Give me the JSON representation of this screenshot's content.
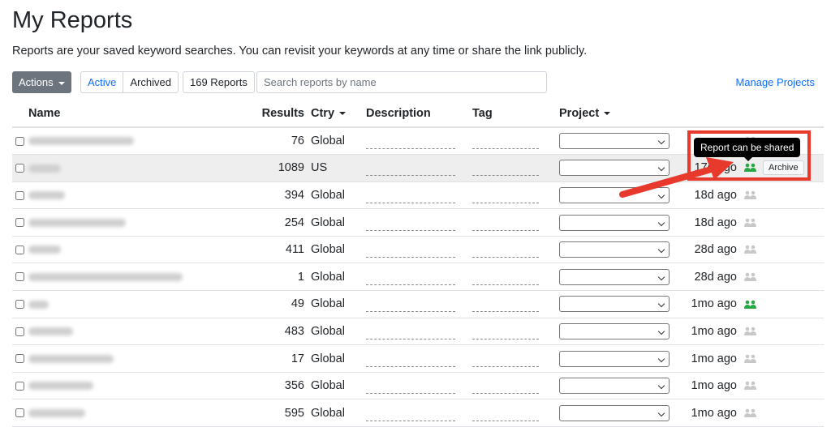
{
  "page": {
    "title": "My Reports",
    "subtitle": "Reports are your saved keyword searches. You can revisit your keywords at any time or share the link publicly."
  },
  "toolbar": {
    "actions_label": "Actions",
    "active_label": "Active",
    "archived_label": "Archived",
    "count_label": "169 Reports",
    "search_placeholder": "Search reports by name",
    "manage_label": "Manage Projects"
  },
  "table": {
    "headers": {
      "name": "Name",
      "results": "Results",
      "ctry": "Ctry",
      "description": "Description",
      "tag": "Tag",
      "project": "Project"
    },
    "rows": [
      {
        "results": "76",
        "ctry": "Global",
        "age": "",
        "shared": false
      },
      {
        "results": "1089",
        "ctry": "US",
        "age": "17d ago",
        "shared": true
      },
      {
        "results": "394",
        "ctry": "Global",
        "age": "18d ago",
        "shared": false
      },
      {
        "results": "254",
        "ctry": "Global",
        "age": "18d ago",
        "shared": false
      },
      {
        "results": "411",
        "ctry": "Global",
        "age": "28d ago",
        "shared": false
      },
      {
        "results": "1",
        "ctry": "Global",
        "age": "28d ago",
        "shared": false
      },
      {
        "results": "49",
        "ctry": "Global",
        "age": "1mo ago",
        "shared": true
      },
      {
        "results": "483",
        "ctry": "Global",
        "age": "1mo ago",
        "shared": false
      },
      {
        "results": "17",
        "ctry": "Global",
        "age": "1mo ago",
        "shared": false
      },
      {
        "results": "356",
        "ctry": "Global",
        "age": "1mo ago",
        "shared": false
      },
      {
        "results": "595",
        "ctry": "Global",
        "age": "1mo ago",
        "shared": false
      }
    ]
  },
  "tooltip": {
    "text": "Report can be shared"
  },
  "archive_label": "Archive",
  "icons": {
    "share": "users-icon"
  },
  "colors": {
    "accent": "#0d6efd",
    "shared": "#28a745",
    "unshared": "#c8c8c8",
    "annotation": "#e8392d"
  }
}
